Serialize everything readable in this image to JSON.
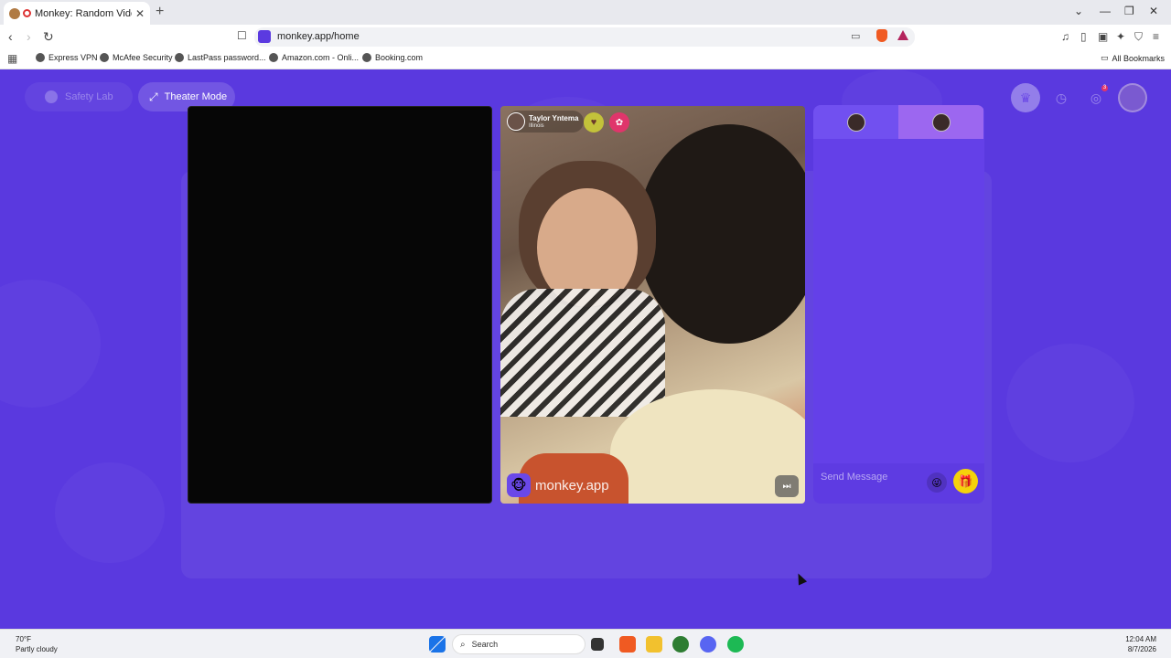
{
  "browser": {
    "tab_title": "Monkey: Random Video Chat",
    "url": "monkey.app/home",
    "bookmarks": [
      "Express VPN",
      "McAfee Security",
      "LastPass password...",
      "Amazon.com - Onli...",
      "Booking.com"
    ],
    "all_bookmarks": "All Bookmarks"
  },
  "header": {
    "safety_lab": "Safety Lab",
    "theater_mode": "Theater Mode",
    "notification_count": "3"
  },
  "peer": {
    "name": "Taylor Yntema",
    "location": "Illinois",
    "brand": "monkey.app"
  },
  "chat": {
    "placeholder": "Send Message"
  },
  "taskbar": {
    "temp": "70°F",
    "condition": "Partly cloudy",
    "search": "Search",
    "time": "12:04 AM",
    "date": "8/7/2026"
  },
  "colors": {
    "page_bg": "#5a39df",
    "chat_bg": "#6440e8",
    "gift": "#f5d20b"
  }
}
